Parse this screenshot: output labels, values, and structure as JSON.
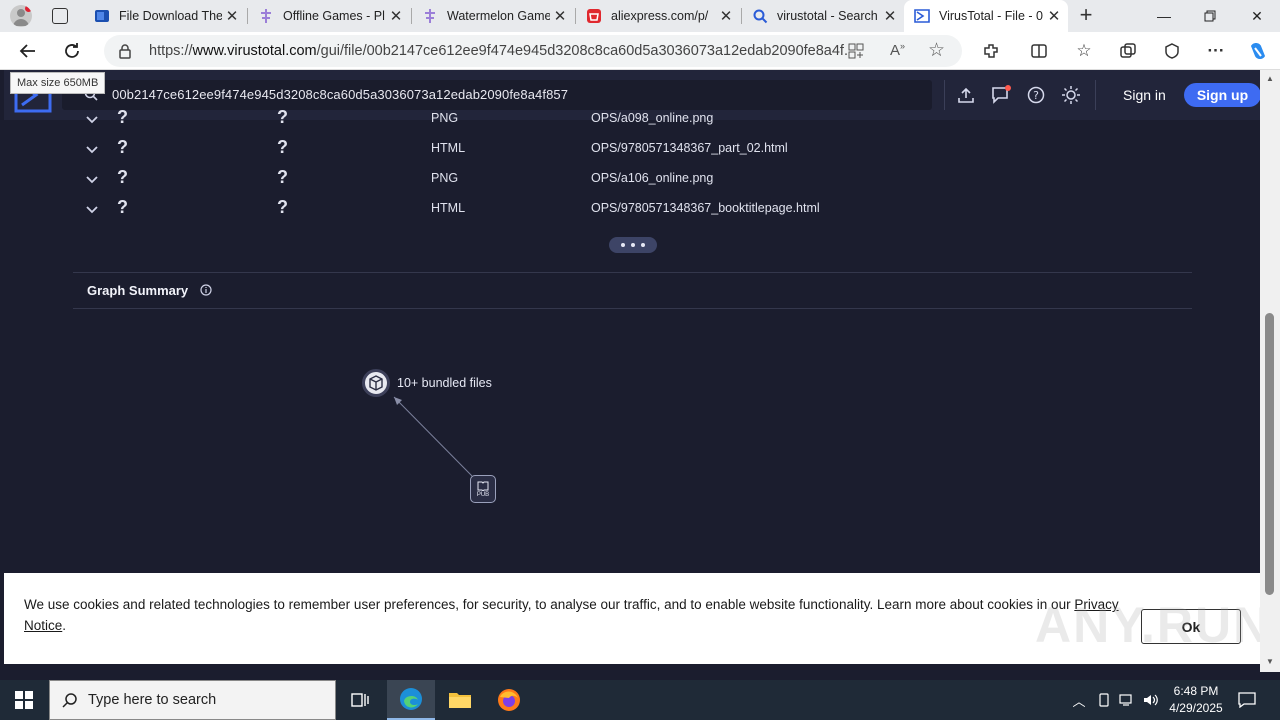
{
  "browser": {
    "tabs": [
      {
        "title": "File Download The",
        "icon": "blue-app-icon"
      },
      {
        "title": "Offline Games - Pl",
        "icon": "pinwheel-icon"
      },
      {
        "title": "Watermelon Game",
        "icon": "pinwheel-icon"
      },
      {
        "title": "aliexpress.com/p/",
        "icon": "aliexpress-icon"
      },
      {
        "title": "virustotal - Search",
        "icon": "search-icon"
      },
      {
        "title": "VirusTotal - File - 0",
        "icon": "virustotal-icon",
        "active": true
      }
    ],
    "url_prefix": "https://",
    "url_domain": "www.virustotal.com",
    "url_rest": "/gui/file/00b2147ce612ee9f474e945d3208c8ca60d5a3036073a12edab2090fe8a4f...",
    "tooltip": "Max size 650MB"
  },
  "vt": {
    "search_value": "00b2147ce612ee9f474e945d3208c8ca60d5a3036073a12edab2090fe8a4f857",
    "sign_in": "Sign in",
    "sign_up": "Sign up",
    "rows": [
      {
        "c1": "?",
        "c2": "?",
        "type": "PNG",
        "path": "OPS/a098_online.png"
      },
      {
        "c1": "?",
        "c2": "?",
        "type": "HTML",
        "path": "OPS/9780571348367_part_02.html"
      },
      {
        "c1": "?",
        "c2": "?",
        "type": "PNG",
        "path": "OPS/a106_online.png"
      },
      {
        "c1": "?",
        "c2": "?",
        "type": "HTML",
        "path": "OPS/9780571348367_booktitlepage.html"
      }
    ],
    "graph_summary_title": "Graph Summary",
    "graph": {
      "bundle_label": "10+ bundled files",
      "file_label": "PUB"
    }
  },
  "cookie": {
    "text": "We use cookies and related technologies to remember user preferences, for security, to analyse our traffic, and to enable website functionality. Learn more about cookies in our ",
    "link_part1": "Privacy",
    "link_part2": "Notice",
    "ok": "Ok"
  },
  "taskbar": {
    "search_placeholder": "Type here to search",
    "time": "6:48 PM",
    "date": "4/29/2025"
  },
  "watermark": "ANY.RUN"
}
